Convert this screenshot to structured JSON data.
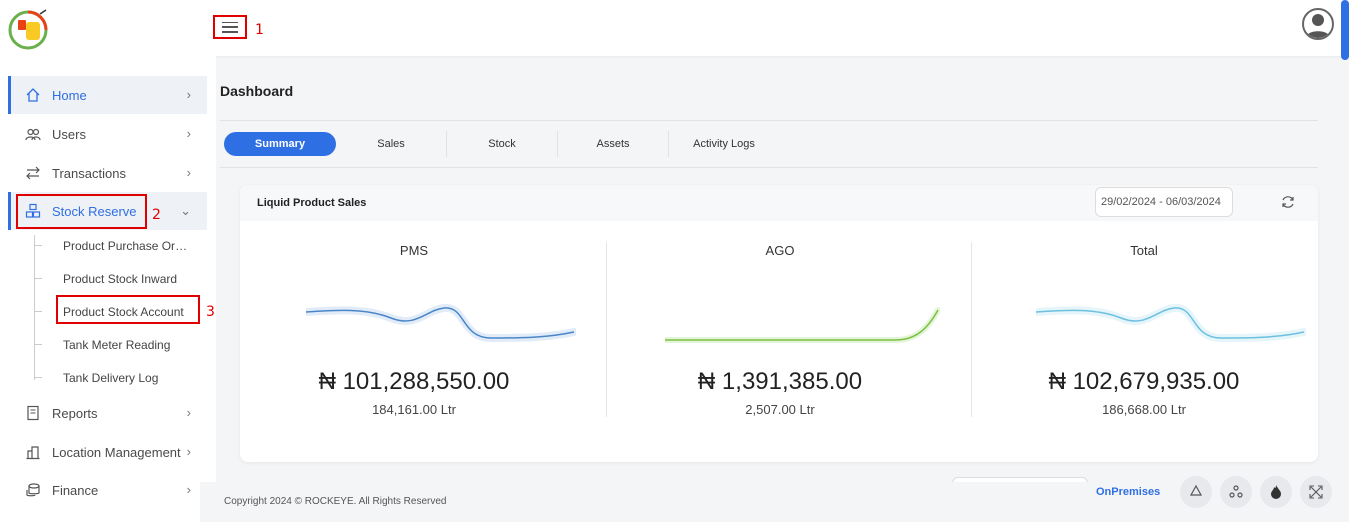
{
  "annotations": {
    "a1": "1",
    "a2": "2",
    "a3": "3"
  },
  "sidebar": {
    "items": [
      {
        "label": "Home",
        "icon": "home-icon"
      },
      {
        "label": "Users",
        "icon": "users-icon"
      },
      {
        "label": "Transactions",
        "icon": "transfer-icon"
      },
      {
        "label": "Stock Reserve",
        "icon": "boxes-icon"
      },
      {
        "label": "Reports",
        "icon": "document-icon"
      },
      {
        "label": "Location Management",
        "icon": "building-icon"
      },
      {
        "label": "Finance",
        "icon": "coins-icon"
      }
    ],
    "sub_items": [
      "Product Purchase Order",
      "Product Stock Inward",
      "Product Stock Account",
      "Tank Meter Reading",
      "Tank Delivery Log"
    ]
  },
  "page": {
    "title": "Dashboard"
  },
  "tabs": [
    "Summary",
    "Sales",
    "Stock",
    "Assets",
    "Activity Logs"
  ],
  "card": {
    "title": "Liquid Product Sales",
    "date_range": "29/02/2024 - 06/03/2024",
    "metrics": [
      {
        "label": "PMS",
        "value": "₦ 101,288,550.00",
        "volume": "184,161.00 Ltr"
      },
      {
        "label": "AGO",
        "value": "₦ 1,391,385.00",
        "volume": "2,507.00 Ltr"
      },
      {
        "label": "Total",
        "value": "₦ 102,679,935.00",
        "volume": "186,668.00 Ltr"
      }
    ]
  },
  "footer": {
    "copyright": "Copyright 2024 © ROCKEYE. All Rights Reserved",
    "mode": "OnPremises"
  },
  "colors": {
    "accent": "#2f6fe4",
    "annotation": "#e00000",
    "pms_line": "#4a86c8",
    "ago_line": "#7bc043",
    "total_line": "#6cc0e0"
  }
}
